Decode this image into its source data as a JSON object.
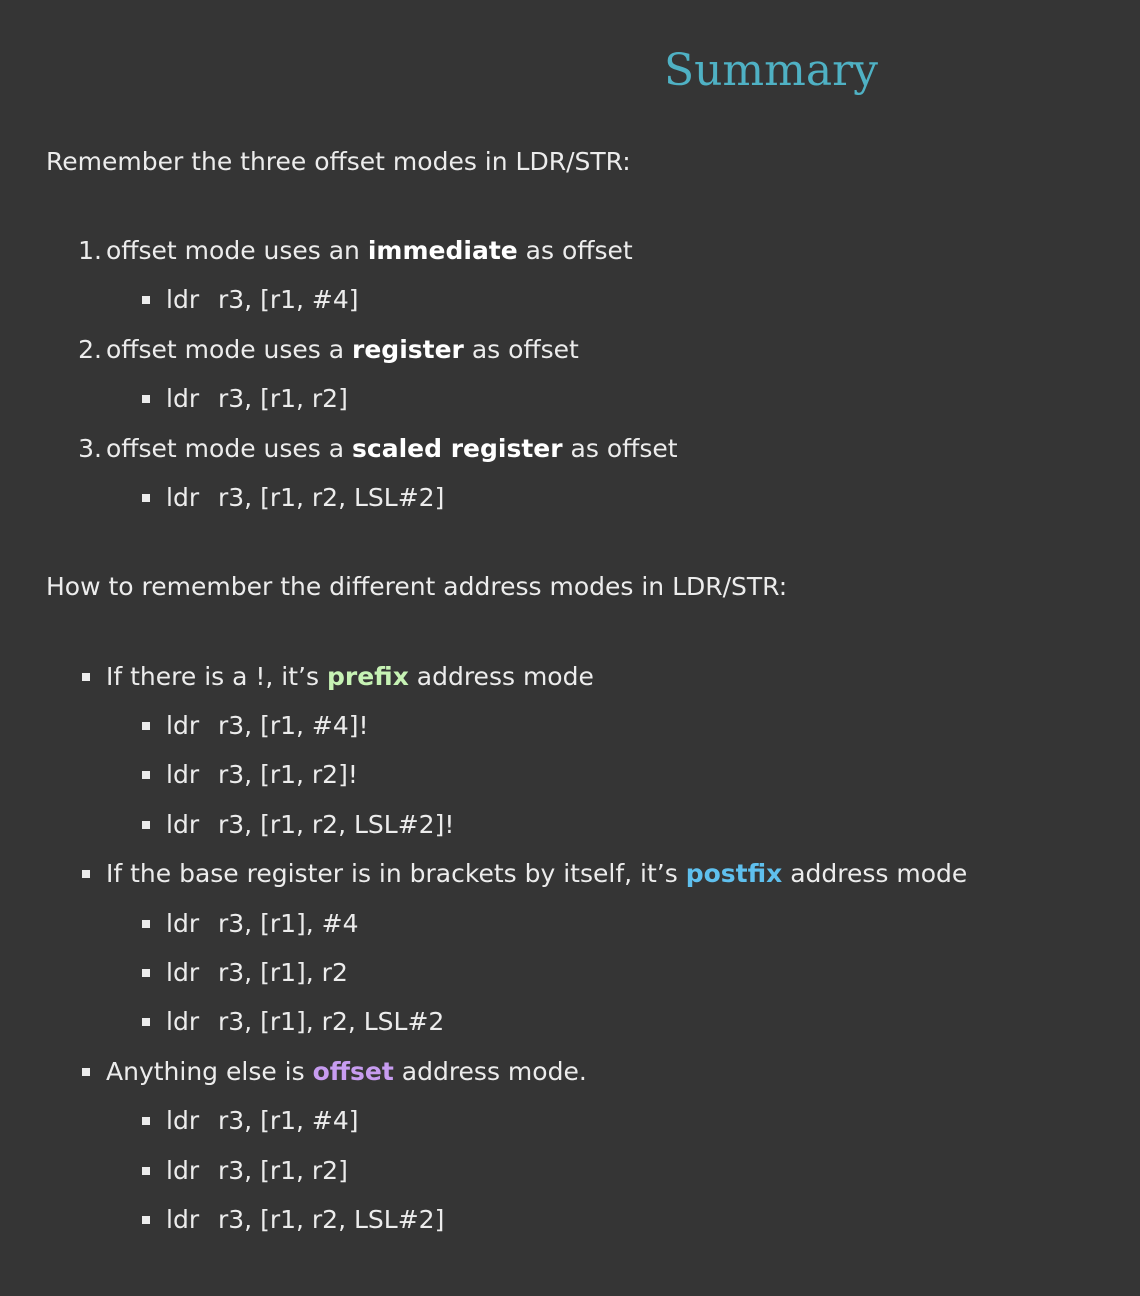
{
  "title": "Summary",
  "intro_offset": "Remember the three offset modes in LDR/STR:",
  "offset_modes": [
    {
      "num": "1.",
      "pre": "offset mode uses an ",
      "em": "immediate",
      "post": " as offset",
      "op": "ldr",
      "args": "r3, [r1, #4]"
    },
    {
      "num": "2.",
      "pre": "offset mode uses a ",
      "em": "register",
      "post": " as offset",
      "op": "ldr",
      "args": "r3, [r1, r2]"
    },
    {
      "num": "3.",
      "pre": "offset mode uses a ",
      "em": "scaled register",
      "post": " as offset",
      "op": "ldr",
      "args": "r3, [r1, r2, LSL#2]"
    }
  ],
  "intro_address": "How to remember the different address modes in LDR/STR:",
  "address_modes": [
    {
      "pre": "If there is a !, it’s ",
      "em": "prefix",
      "post": " address mode",
      "color": "#c6f2b4",
      "examples": [
        {
          "op": "ldr",
          "args": "r3, [r1, #4]!"
        },
        {
          "op": "ldr",
          "args": "r3, [r1, r2]!"
        },
        {
          "op": "ldr",
          "args": "r3, [r1, r2, LSL#2]!"
        }
      ]
    },
    {
      "pre": "If the base register is in brackets by itself, it’s ",
      "em": "postfix",
      "post": " address mode",
      "color": "#5fc0ee",
      "examples": [
        {
          "op": "ldr",
          "args": "r3, [r1], #4"
        },
        {
          "op": "ldr",
          "args": "r3, [r1], r2"
        },
        {
          "op": "ldr",
          "args": "r3, [r1], r2, LSL#2"
        }
      ]
    },
    {
      "pre": "Anything else is ",
      "em": "offset",
      "post": " address mode.",
      "color": "#c79cf0",
      "examples": [
        {
          "op": "ldr",
          "args": "r3, [r1, #4]"
        },
        {
          "op": "ldr",
          "args": "r3, [r1, r2]"
        },
        {
          "op": "ldr",
          "args": "r3, [r1, r2, LSL#2]"
        }
      ]
    }
  ]
}
